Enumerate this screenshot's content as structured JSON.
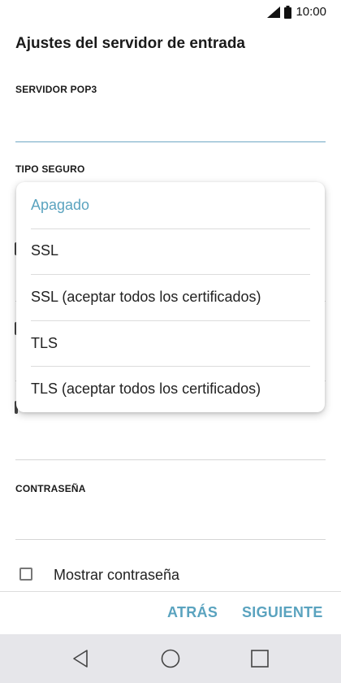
{
  "status_bar": {
    "time": "10:00",
    "signal_icon": "signal-icon",
    "battery_icon": "battery-icon"
  },
  "header": {
    "title": "Ajustes del servidor de entrada"
  },
  "fields": {
    "pop3_server_label": "SERVIDOR POP3",
    "security_type_label": "TIPO SEGURO",
    "password_label": "CONTRASEÑA"
  },
  "dropdown": {
    "selected": "Apagado",
    "options": [
      "Apagado",
      "SSL",
      "SSL (aceptar todos los certificados)",
      "TLS",
      "TLS (aceptar todos los certificados)"
    ]
  },
  "show_password": {
    "label": "Mostrar contraseña",
    "checked": false
  },
  "actions": {
    "back_label": "ATRÁS",
    "next_label": "SIGUIENTE"
  },
  "system_nav": {
    "icons": [
      "back-triangle-icon",
      "home-circle-icon",
      "recents-square-icon"
    ]
  },
  "colors": {
    "accent": "#5aa3bf",
    "nav_bar": "#e6e6ea"
  }
}
